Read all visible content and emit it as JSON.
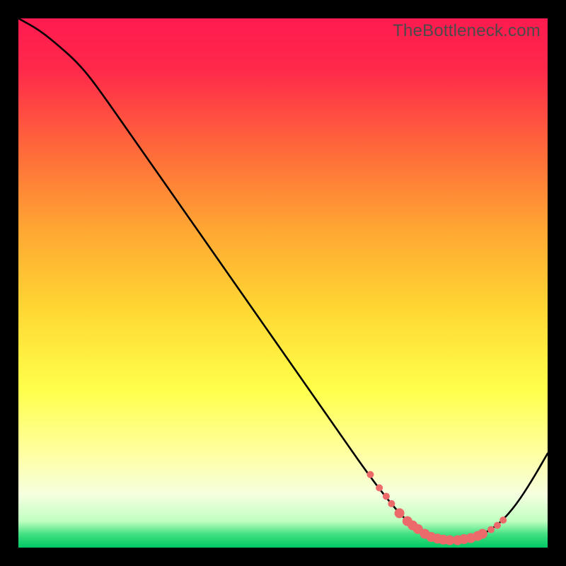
{
  "watermark": "TheBottleneck.com",
  "chart_data": {
    "type": "line",
    "title": "",
    "xlabel": "",
    "ylabel": "",
    "xlim": [
      0,
      100
    ],
    "ylim": [
      0,
      100
    ],
    "gradient_stops": [
      {
        "offset": 0.0,
        "color": "#ff1a4f"
      },
      {
        "offset": 0.1,
        "color": "#ff2a4a"
      },
      {
        "offset": 0.25,
        "color": "#ff6a3a"
      },
      {
        "offset": 0.4,
        "color": "#ffa733"
      },
      {
        "offset": 0.55,
        "color": "#ffd733"
      },
      {
        "offset": 0.7,
        "color": "#ffff4a"
      },
      {
        "offset": 0.82,
        "color": "#ffffa0"
      },
      {
        "offset": 0.9,
        "color": "#f5ffe0"
      },
      {
        "offset": 0.95,
        "color": "#c0ffc0"
      },
      {
        "offset": 0.975,
        "color": "#40e080"
      },
      {
        "offset": 1.0,
        "color": "#00c865"
      }
    ],
    "curve": [
      {
        "x": 0,
        "y": 100
      },
      {
        "x": 4,
        "y": 97.8
      },
      {
        "x": 8,
        "y": 94.5
      },
      {
        "x": 11,
        "y": 91.8
      },
      {
        "x": 14,
        "y": 88.3
      },
      {
        "x": 20,
        "y": 79.8
      },
      {
        "x": 30,
        "y": 65.5
      },
      {
        "x": 40,
        "y": 51.2
      },
      {
        "x": 50,
        "y": 36.9
      },
      {
        "x": 60,
        "y": 22.6
      },
      {
        "x": 66,
        "y": 14.0
      },
      {
        "x": 70,
        "y": 8.8
      },
      {
        "x": 73,
        "y": 5.4
      },
      {
        "x": 76,
        "y": 3.0
      },
      {
        "x": 79,
        "y": 1.8
      },
      {
        "x": 82,
        "y": 1.4
      },
      {
        "x": 85,
        "y": 1.6
      },
      {
        "x": 88,
        "y": 2.6
      },
      {
        "x": 91,
        "y": 4.6
      },
      {
        "x": 94,
        "y": 8.0
      },
      {
        "x": 97,
        "y": 12.6
      },
      {
        "x": 100,
        "y": 17.8
      }
    ],
    "markers": [
      {
        "x": 66.5,
        "y": 13.8
      },
      {
        "x": 68.2,
        "y": 11.3
      },
      {
        "x": 69.5,
        "y": 9.7
      },
      {
        "x": 70.5,
        "y": 8.3
      },
      {
        "x": 72.0,
        "y": 6.5
      },
      {
        "x": 73.5,
        "y": 5.0
      },
      {
        "x": 74.5,
        "y": 4.2
      },
      {
        "x": 75.5,
        "y": 3.5
      },
      {
        "x": 76.8,
        "y": 2.6
      },
      {
        "x": 78.0,
        "y": 2.0
      },
      {
        "x": 79.2,
        "y": 1.7
      },
      {
        "x": 80.3,
        "y": 1.5
      },
      {
        "x": 81.5,
        "y": 1.4
      },
      {
        "x": 83.0,
        "y": 1.4
      },
      {
        "x": 84.2,
        "y": 1.6
      },
      {
        "x": 85.5,
        "y": 1.8
      },
      {
        "x": 86.8,
        "y": 2.2
      },
      {
        "x": 87.7,
        "y": 2.6
      },
      {
        "x": 89.3,
        "y": 3.4
      },
      {
        "x": 90.5,
        "y": 4.2
      },
      {
        "x": 91.6,
        "y": 5.2
      }
    ],
    "marker_color": "#ed6a6a",
    "curve_color": "#000000",
    "curve_width": 2.6,
    "marker_radius_small": 5.0,
    "marker_radius_large": 7.0
  }
}
